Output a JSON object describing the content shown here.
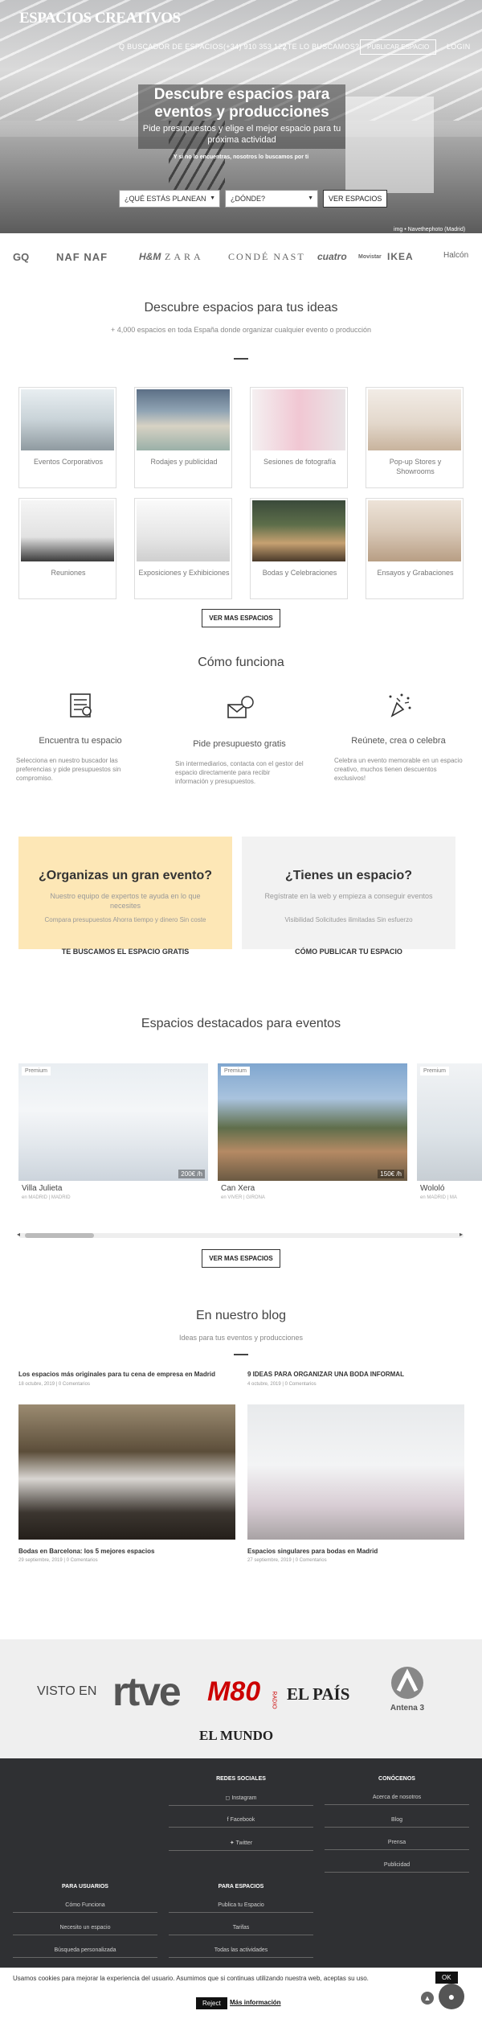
{
  "nav": {
    "logo": "ESPACIOS CREATIVOS",
    "search": "Q BUSCADOR DE ESPACIOS",
    "phone": "(+34) 910 353 122",
    "find": "¿TE LO BUSCAMOS?",
    "publish": "PUBLICAR ESPACIO",
    "login": "LOGIN"
  },
  "hero": {
    "title": "Descubre espacios para eventos y producciones",
    "subtitle": "Pide presupuestos y elige el mejor espacio para tu próxima actividad",
    "note": "Y si no lo encuentras, nosotros lo buscamos por ti",
    "select_event": "¿QUÉ ESTÁS PLANEAN",
    "select_where": "¿DÓNDE?",
    "cta": "VER ESPACIOS",
    "credit": "img • Navethephoto (Madrid)"
  },
  "brands": [
    "GQ",
    "NAF NAF",
    "H&M",
    "ZARA",
    "CONDÉ NAST",
    "cuatro",
    "Movistar",
    "IKEA",
    "Halcón"
  ],
  "discover": {
    "title": "Descubre espacios para tus ideas",
    "subtitle": "+ 4,000 espacios en toda España donde organizar cualquier evento o producción",
    "categories": [
      "Eventos Corporativos",
      "Rodajes y publicidad",
      "Sesiones de fotografía",
      "Pop-up Stores y Showrooms",
      "Reuniones",
      "Exposiciones y Exhibiciones",
      "Bodas y Celebraciones",
      "Ensayos y Grabaciones"
    ],
    "button": "VER MAS ESPACIOS"
  },
  "how": {
    "title": "Cómo funciona",
    "steps": [
      {
        "title": "Encuentra tu espacio",
        "desc": "Selecciona en nuestro buscador las preferencias y pide presupuestos sin compromiso.",
        "icon": "search-list-icon"
      },
      {
        "title": "Pide presupuesto gratis",
        "desc": "Sin intermediarios, contacta con el gestor del espacio directamente para recibir información y presupuestos.",
        "icon": "mail-chat-icon"
      },
      {
        "title": "Reúnete, crea o celebra",
        "desc": "Celebra un evento memorable en un espacio creativo, muchos tienen descuentos exclusivos!",
        "icon": "confetti-icon"
      }
    ]
  },
  "promo": [
    {
      "title": "¿Organizas un gran evento?",
      "desc": "Nuestro equipo de expertos te ayuda en lo que necesites",
      "checks": "Compara presupuestos   Ahorra tiempo y dinero   Sin coste",
      "link": "TE BUSCAMOS EL ESPACIO GRATIS",
      "color": "#fde7b6"
    },
    {
      "title": "¿Tienes un espacio?",
      "desc": "Regístrate en la web y empieza a conseguir eventos",
      "checks": "Visibilidad   Solicitudes ilimitadas   Sin esfuerzo",
      "link": "CÓMO PUBLICAR TU ESPACIO",
      "color": "#f2f2f2"
    }
  ],
  "featured": {
    "title": "Espacios destacados para eventos",
    "badge": "Premium",
    "items": [
      {
        "name": "Villa Julieta",
        "meta": "en MADRID | MADRID",
        "price": "200€ /h"
      },
      {
        "name": "Can Xera",
        "meta": "en VIVER | GIRONA",
        "price": "150€ /h"
      },
      {
        "name": "Wololó",
        "meta": "en MADRID | MA",
        "price": ""
      }
    ],
    "button": "VER MAS ESPACIOS"
  },
  "blog": {
    "title": "En nuestro blog",
    "subtitle": "Ideas para tus eventos y producciones",
    "posts": [
      {
        "title": "Los espacios más originales para tu cena de empresa en Madrid",
        "date": "18 octubre, 2019 | 0 Comentarios"
      },
      {
        "title": "9 IDEAS PARA ORGANIZAR UNA BODA INFORMAL",
        "date": "4 octubre, 2019 | 0 Comentarios"
      },
      {
        "title": "Bodas en Barcelona: los 5 mejores espacios",
        "date": "29 septiembre, 2019 | 0 Comentarios"
      },
      {
        "title": "Espacios singulares para bodas en Madrid",
        "date": "27 septiembre, 2019 | 0 Comentarios"
      }
    ]
  },
  "visto": {
    "label": "VISTO EN",
    "logos": [
      "rtve",
      "M80",
      "RADIO",
      "EL PAÍS",
      "Antena 3",
      "EL MUNDO"
    ]
  },
  "footer": {
    "col_social": {
      "title": "REDES SOCIALES",
      "links": [
        "Instagram",
        "Facebook",
        "Twitter"
      ]
    },
    "col_about": {
      "title": "CONÓCENOS",
      "links": [
        "Acerca de nosotros",
        "Blog",
        "Prensa",
        "Publicidad"
      ]
    },
    "col_users": {
      "title": "PARA USUARIOS",
      "links": [
        "Cómo Funciona",
        "Necesito un espacio",
        "Búsqueda personalizada"
      ]
    },
    "col_spaces": {
      "title": "PARA ESPACIOS",
      "links": [
        "Publica tu Espacio",
        "Tarifas",
        "Todas las actividades"
      ]
    }
  },
  "cookie": {
    "text": "Usamos cookies para mejorar la experiencia del usuario. Asumimos que si continuas utilizando nuestra web, aceptas su uso.",
    "ok": "OK",
    "reject": "Reject",
    "more": "Más información"
  }
}
